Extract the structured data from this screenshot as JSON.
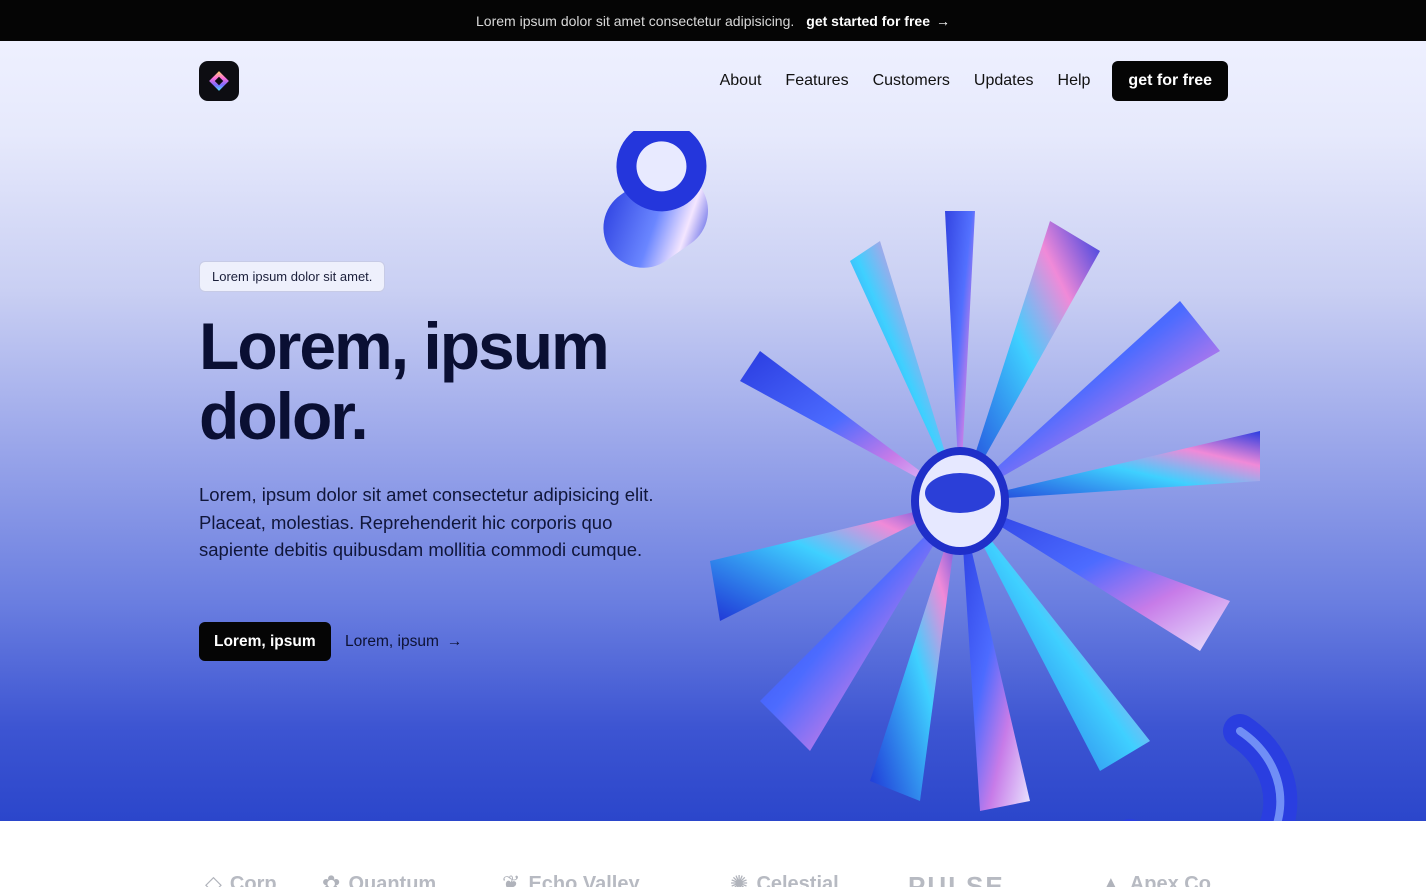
{
  "announcement": {
    "text": "Lorem ipsum dolor sit amet consectetur adipisicing.",
    "cta": "get started for free",
    "cta_icon": "arrow-right-icon"
  },
  "nav": {
    "logo_icon": "diamond-logo-icon",
    "items": [
      "About",
      "Features",
      "Customers",
      "Updates",
      "Help"
    ],
    "cta": "get for free"
  },
  "hero": {
    "badge": "Lorem ipsum dolor sit amet.",
    "headline_line1": "Lorem, ipsum",
    "headline_line2": "dolor.",
    "description": "Lorem, ipsum dolor sit amet consectetur adipisicing elit. Placeat, molestias. Reprehenderit hic corporis quo sapiente debitis quibusdam mollitia commodi cumque.",
    "primary_button": "Lorem, ipsum",
    "secondary_link": "Lorem, ipsum",
    "secondary_icon": "arrow-right-icon"
  },
  "logos": {
    "items": [
      "Corp",
      "Quantum",
      "Echo Valley",
      "Celestial",
      "PULSE",
      "Apex Co"
    ]
  },
  "colors": {
    "accent": "#2b46cb",
    "dark": "#050505"
  }
}
